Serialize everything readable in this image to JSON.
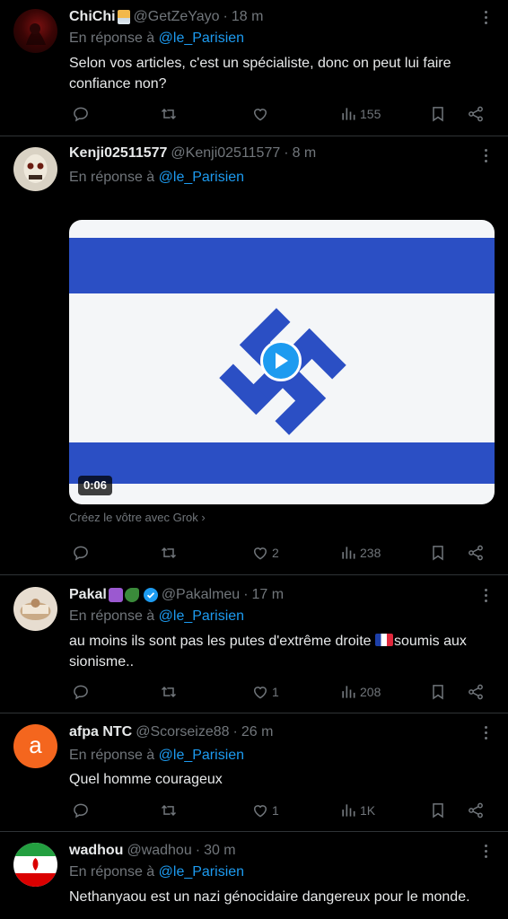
{
  "tweets": [
    {
      "name": "ChiChi",
      "emoji": "tumbler-glass-emoji",
      "handle": "@GetZeYayo",
      "time": "18 m",
      "reply_prefix": "En réponse à",
      "reply_to": "@le_Parisien",
      "text": "Selon vos articles, c'est un spécialiste, donc on peut lui faire confiance non?",
      "replies": "",
      "retweets": "",
      "likes": "",
      "views": "155"
    },
    {
      "name": "Kenji02511577",
      "handle": "@Kenji02511577",
      "time": "8 m",
      "reply_prefix": "En réponse à",
      "reply_to": "@le_Parisien",
      "video_duration": "0:06",
      "grok_note": "Créez le vôtre avec Grok",
      "replies": "",
      "retweets": "",
      "likes": "2",
      "views": "238"
    },
    {
      "name": "Pakal",
      "emoji": "yin-yang-tractor-emoji",
      "handle": "@Pakalmeu",
      "time": "17 m",
      "reply_prefix": "En réponse à",
      "reply_to": "@le_Parisien",
      "text_a": "au moins ils sont pas les putes d'extrême droite ",
      "text_b": "soumis aux sionisme..",
      "replies": "",
      "retweets": "",
      "likes": "1",
      "views": "208"
    },
    {
      "name": "afpa NTC",
      "avatar_letter": "a",
      "handle": "@Scorseize88",
      "time": "26 m",
      "reply_prefix": "En réponse à",
      "reply_to": "@le_Parisien",
      "text": "Quel homme courageux",
      "replies": "",
      "retweets": "",
      "likes": "1",
      "views": "1K"
    },
    {
      "name": "wadhou",
      "handle": "@wadhou",
      "time": "30 m",
      "reply_prefix": "En réponse à",
      "reply_to": "@le_Parisien",
      "text": "Nethanyaou est un nazi génocidaire dangereux pour le monde."
    }
  ],
  "colors": {
    "background": "#000000",
    "text": "#e7e9ea",
    "muted": "#71767b",
    "link": "#1d9bf0",
    "border": "#2f3336",
    "verified": "#1d9bf0"
  }
}
